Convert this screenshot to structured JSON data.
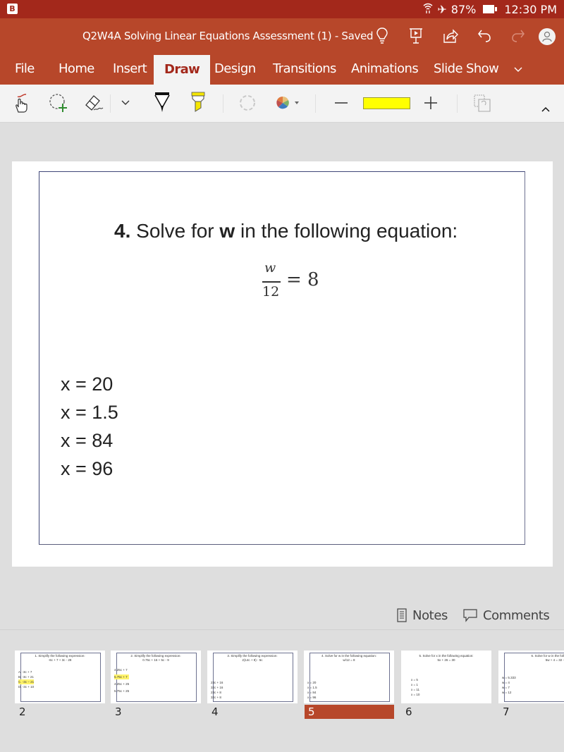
{
  "status_bar": {
    "app_badge": "B",
    "battery": "87%",
    "time": "12:30 PM",
    "icons": [
      "wifi-icon",
      "airplane-icon",
      "battery-icon"
    ]
  },
  "title_bar": {
    "document_title": "Q2W4A Solving Linear Equations Assessment (1) - Saved",
    "icons": [
      "lightbulb-icon",
      "present-icon",
      "share-icon",
      "undo-icon",
      "redo-icon",
      "account-avatar"
    ]
  },
  "ribbon_tabs": [
    {
      "label": "File",
      "active": false
    },
    {
      "label": "Home",
      "active": false
    },
    {
      "label": "Insert",
      "active": false
    },
    {
      "label": "Draw",
      "active": true
    },
    {
      "label": "Design",
      "active": false
    },
    {
      "label": "Transitions",
      "active": false
    },
    {
      "label": "Animations",
      "active": false
    },
    {
      "label": "Slide Show",
      "active": false
    }
  ],
  "ribbon_tools": {
    "items": [
      "touch-draw",
      "lasso-select",
      "eraser",
      "more",
      "black-pen",
      "yellow-highlighter",
      "pen-ring",
      "color-palette",
      "decrease-thickness",
      "current-color",
      "increase-thickness",
      "convert-ink"
    ],
    "current_color": "#ffff00"
  },
  "slide": {
    "question_number": "4.",
    "question_text_before": " Solve for ",
    "question_variable": "w",
    "question_text_after": " in the following equation:",
    "equation": {
      "numerator": "w",
      "denominator": "12",
      "rhs": "= 8"
    },
    "answers": [
      "x = 20",
      "x = 1.5",
      "x = 84",
      "x = 96"
    ]
  },
  "bottom_bar": {
    "notes_label": "Notes",
    "comments_label": "Comments"
  },
  "thumbnails": [
    {
      "number": "2",
      "title": "1. Simplify the following expression:",
      "subtitle": "-6c + 7 + 3c - 28",
      "options": [
        "A.  -3c + 7",
        "B.  -3c + 21",
        "C.  -3c − 21",
        "D.  -3c + 10"
      ],
      "highlighted": 2,
      "active": false
    },
    {
      "number": "3",
      "title": "2. Simplify the following expression:",
      "subtitle": "0.75c + 16 + 5c - 9",
      "options": [
        "4.25c + 7",
        "5.75c + 7",
        "4.25c + 25",
        "5.75c + 25"
      ],
      "highlighted": 1,
      "active": false
    },
    {
      "number": "4",
      "title": "3. Simplify the following expression:",
      "subtitle": "2(14c + 8) - 5c",
      "options": [
        "23c + 16",
        "32c + 16",
        "23c + 8",
        "32c + 8"
      ],
      "highlighted": -1,
      "active": false
    },
    {
      "number": "5",
      "title": "4. Solve for w in the following equation:",
      "subtitle": "w/12 = 8",
      "options": [
        "x = 20",
        "x = 1.5",
        "x = 84",
        "x = 96"
      ],
      "highlighted": -1,
      "active": true
    },
    {
      "number": "6",
      "title": "5. Solve for x in the following equation:",
      "subtitle": "5x + 26 = 30",
      "options": [
        "x = 5",
        "x = 1",
        "x = 11",
        "x = 10"
      ],
      "highlighted": -1,
      "active": false
    },
    {
      "number": "7",
      "title": "6. Solve for w in the foll",
      "subtitle": "5w + 4 = 32 -",
      "options": [
        "w = 5.333",
        "w = 4",
        "w = 7",
        "w = 12"
      ],
      "highlighted": -1,
      "active": false
    }
  ],
  "colors": {
    "status_bar": "#a3281b",
    "brand": "#b7472a",
    "ribbon_bg": "#f3f3f3",
    "workspace_bg": "#dedede",
    "slide_frame": "#3f4678"
  }
}
